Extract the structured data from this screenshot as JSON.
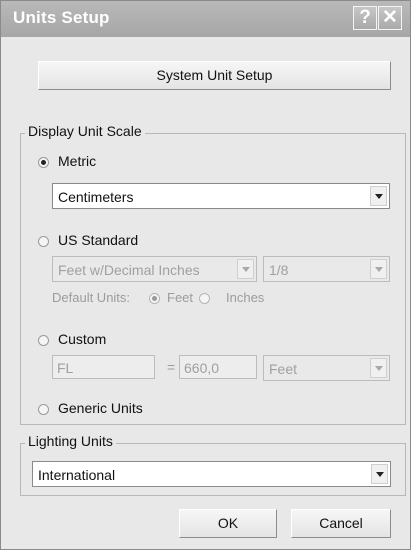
{
  "window": {
    "title": "Units Setup",
    "help_glyph": "?",
    "close_glyph": "✕"
  },
  "system_unit_setup_label": "System Unit Setup",
  "display_unit_scale": {
    "legend": "Display Unit Scale",
    "metric": {
      "label": "Metric",
      "selected": true,
      "value": "Centimeters"
    },
    "us_standard": {
      "label": "US Standard",
      "format_value": "Feet w/Decimal Inches",
      "fraction_value": "1/8",
      "default_units_label": "Default Units:",
      "feet_label": "Feet",
      "inches_label": "Inches"
    },
    "custom": {
      "label": "Custom",
      "name_value": "FL",
      "equals": "=",
      "amount_value": "660,0",
      "unit_value": "Feet"
    },
    "generic": {
      "label": "Generic Units"
    }
  },
  "lighting_units": {
    "legend": "Lighting Units",
    "value": "International"
  },
  "buttons": {
    "ok": "OK",
    "cancel": "Cancel"
  }
}
